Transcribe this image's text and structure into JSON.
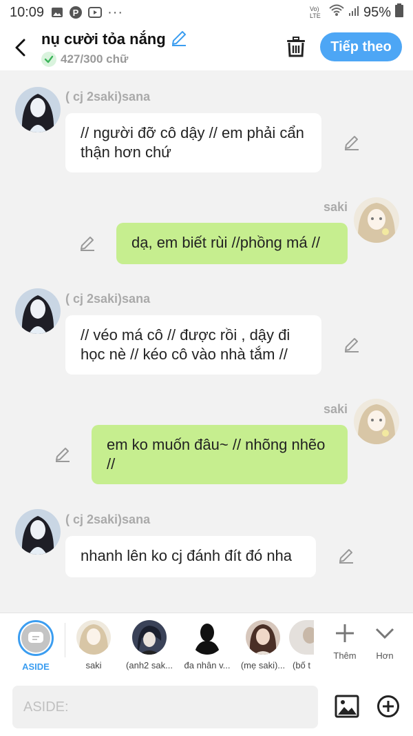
{
  "status_bar": {
    "time": "10:09",
    "battery": "95%",
    "more": "···",
    "network": "Vo) LTE"
  },
  "header": {
    "title": "nụ cười tỏa nắng",
    "word_count": "427/300 chữ",
    "next_label": "Tiếp theo"
  },
  "messages": [
    {
      "sender": "( cj 2saki)sana",
      "text": "// người đỡ cô dậy // em phải cẩn thận hơn chứ",
      "side": "left"
    },
    {
      "sender": "saki",
      "text": "dạ, em biết rùi //phồng má //",
      "side": "right"
    },
    {
      "sender": "( cj 2saki)sana",
      "text": "// véo má cô // được rồi , dậy đi học nè // kéo cô vào nhà tắm //",
      "side": "left"
    },
    {
      "sender": "saki",
      "text": "em ko muốn đâu~ // nhõng nhẽo //",
      "side": "right"
    },
    {
      "sender": "( cj 2saki)sana",
      "text": "nhanh lên ko cj đánh đít đó nha",
      "side": "left"
    }
  ],
  "characters": [
    {
      "label": "ASIDE",
      "selected": true
    },
    {
      "label": "saki"
    },
    {
      "label": "(anh2 sak..."
    },
    {
      "label": "đa nhân v..."
    },
    {
      "label": "(mẹ saki)..."
    },
    {
      "label": "(bố t"
    }
  ],
  "tools": {
    "add_label": "Thêm",
    "more_label": "Hơn"
  },
  "input": {
    "placeholder": "ASIDE:"
  },
  "colors": {
    "accent": "#4da6f5",
    "bubble_self": "#c6ee8f",
    "bubble_other": "#ffffff",
    "background": "#f2f2f2"
  },
  "icons": {
    "avatar_sana": "dark-haired-character-avatar",
    "avatar_saki": "blonde-character-avatar",
    "edit": "pencil-icon",
    "back": "chevron-left-icon",
    "delete": "trash-icon",
    "image": "image-icon",
    "add": "plus-circle-icon"
  }
}
